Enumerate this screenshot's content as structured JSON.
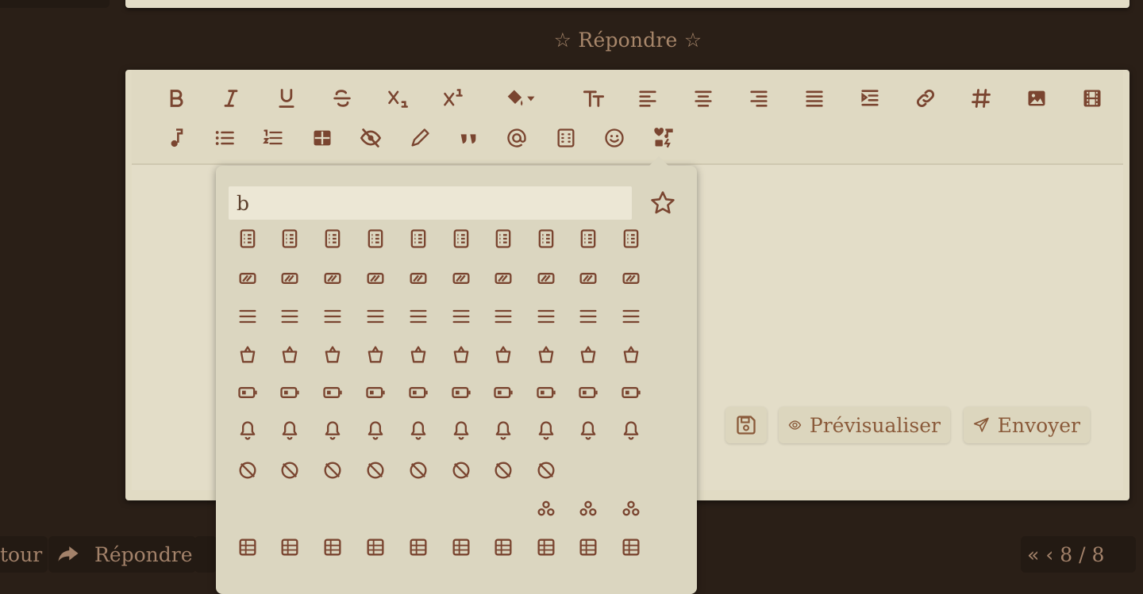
{
  "header": {
    "reply_heading": "☆ Répondre ☆"
  },
  "toolbar": {
    "row1": [
      "bold-icon",
      "italic-icon",
      "underline-icon",
      "strikethrough-icon",
      "subscript-icon",
      "superscript-icon",
      "paint-bucket-icon",
      "text-size-icon",
      "align-left-icon",
      "align-center-icon",
      "align-right-icon",
      "align-justify-icon",
      "indent-icon",
      "link-icon",
      "hashtag-icon",
      "image-icon",
      "film-icon"
    ],
    "row2": [
      "music-note-icon",
      "bullet-list-icon",
      "numbered-list-icon",
      "table-icon",
      "eye-slash-icon",
      "pencil-icon",
      "quote-icon",
      "at-sign-icon",
      "spoiler-box-icon",
      "smiley-icon",
      "emoji-grid-icon"
    ]
  },
  "actions": {
    "save_icon": "floppy-disk-icon",
    "preview_label": "Prévisualiser",
    "send_label": "Envoyer"
  },
  "bottom": {
    "left_partial": "tour",
    "reply_label": "Répondre",
    "page_indicator": "8 / 8"
  },
  "emoji_picker": {
    "search_value": "b",
    "favorite_icon": "star-icon",
    "icons": [
      [
        "ballot-icon",
        "ballot-check-icon",
        "ban-icon",
        "ban-bug-icon",
        "ban-parking-icon",
        "ban-smoking-icon",
        "banana-icon",
        "bandage-icon",
        "bangladeshi-taka-sign-icon",
        "banjo-icon"
      ],
      [
        "bar-progress-icon",
        "bar-progress-empty-icon",
        "bar-progress-full-icon",
        "bar-progress-half-icon",
        "bar-progress-quarter-icon",
        "bar-progress-three-quarters-icon",
        "barcode-icon",
        "barcode-read-icon",
        "barcode-scan-icon",
        "barn-silo-icon"
      ],
      [
        "bars-icon",
        "bars-filter-icon",
        "bars-progress-icon",
        "bars-sort-icon",
        "bars-staggered-icon",
        "baseball-icon",
        "baseball-bat-icon",
        "baseball-bat-ball-icon",
        "basket-shopping-icon",
        "basket-shopping-simple-icon"
      ],
      [
        "basket-shopping-plus-icon",
        "basket-icon",
        "basketball-icon",
        "basketball-hoop-icon",
        "bat-icon",
        "bath-icon",
        "battery-bolt-icon",
        "battery-empty-icon",
        "battery-exclamation-icon",
        "battery-full-icon"
      ],
      [
        "battery-half-icon",
        "battery-low-icon",
        "battery-quarter-icon",
        "battery-slash-icon",
        "battery-three-quarters-icon",
        "bed-icon",
        "bed-bunk-icon",
        "bed-empty-icon",
        "bed-front-icon",
        "bed-pulse-icon"
      ],
      [
        "bee-icon",
        "beer-mug-icon",
        "beer-mug-empty-icon",
        "bell-icon",
        "bell-concierge-icon",
        "bell-exclamation-icon",
        "bell-on-icon",
        "bell-plus-icon",
        "bell-ring-icon",
        "bell-school-icon"
      ],
      [
        "bell-school-slash-icon",
        "bell-slash-icon",
        "bells-icon",
        "bench-tree-icon",
        "bezier-curve-icon",
        "bicep-icon",
        "bicycle-icon",
        "billboard-icon"
      ],
      [
        "biohazard-icon",
        "bird-icon",
        "bitcoin-sign-icon"
      ],
      [
        "blanket-icon",
        "blender-icon",
        "blender-phone-icon",
        "blinds-icon",
        "block-icon",
        "block-brick-icon",
        "block-quote-icon",
        "bold-t-icon",
        "bong-icon",
        "bookmark-lock-icon"
      ]
    ]
  }
}
